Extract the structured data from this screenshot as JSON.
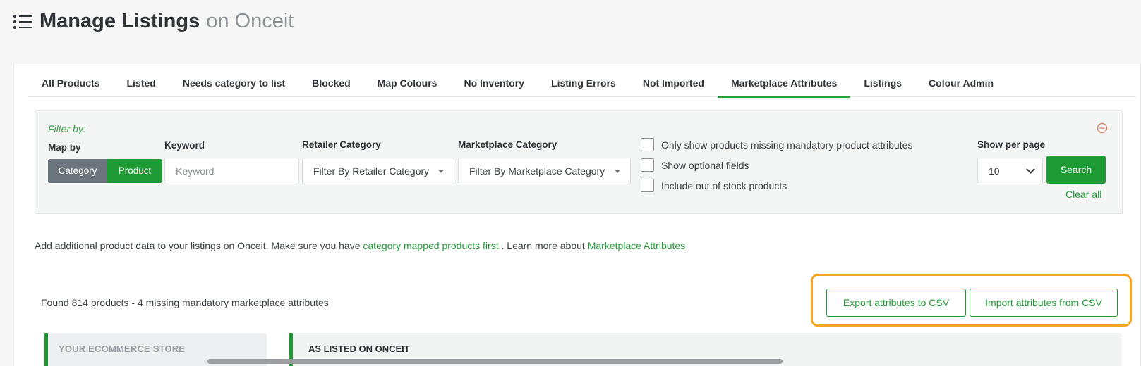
{
  "header": {
    "title": "Manage Listings",
    "subtitle": "on Onceit",
    "icon": "list-icon"
  },
  "tabs": [
    {
      "label": "All Products",
      "active": false
    },
    {
      "label": "Listed",
      "active": false
    },
    {
      "label": "Needs category to list",
      "active": false
    },
    {
      "label": "Blocked",
      "active": false
    },
    {
      "label": "Map Colours",
      "active": false
    },
    {
      "label": "No Inventory",
      "active": false
    },
    {
      "label": "Listing Errors",
      "active": false
    },
    {
      "label": "Not Imported",
      "active": false
    },
    {
      "label": "Marketplace Attributes",
      "active": true
    },
    {
      "label": "Listings",
      "active": false
    },
    {
      "label": "Colour Admin",
      "active": false
    }
  ],
  "filter": {
    "title": "Filter by:",
    "map_by_label": "Map by",
    "map_by_options": [
      "Category",
      "Product"
    ],
    "map_by_selected": "Product",
    "keyword_label": "Keyword",
    "keyword_placeholder": "Keyword",
    "keyword_value": "",
    "retailer_category_label": "Retailer Category",
    "retailer_category_value": "Filter By Retailer Category",
    "marketplace_category_label": "Marketplace Category",
    "marketplace_category_value": "Filter By Marketplace Category",
    "checkboxes": [
      {
        "label": "Only show products missing mandatory product attributes",
        "checked": false
      },
      {
        "label": "Show optional fields",
        "checked": false
      },
      {
        "label": "Include out of stock products",
        "checked": false
      }
    ],
    "per_page_label": "Show per page",
    "per_page_value": "10",
    "search_label": "Search",
    "clear_label": "Clear all",
    "collapse_icon": "minus-circle-icon"
  },
  "info": {
    "text_1": "Add additional product data to your listings on Onceit. Make sure you have",
    "link_1": "category mapped products first",
    "text_2": ". Learn more about",
    "link_2": "Marketplace Attributes"
  },
  "results": {
    "found_text": "Found 814 products - 4 missing mandatory marketplace attributes",
    "export_label": "Export attributes to CSV",
    "import_label": "Import attributes from CSV"
  },
  "table": {
    "store_header": "YOUR ECOMMERCE STORE",
    "listed_header": "AS LISTED ON ONCEIT"
  },
  "colors": {
    "accent": "#1f9b35",
    "highlight": "#f6a623",
    "secondary_button": "#6c757d"
  }
}
